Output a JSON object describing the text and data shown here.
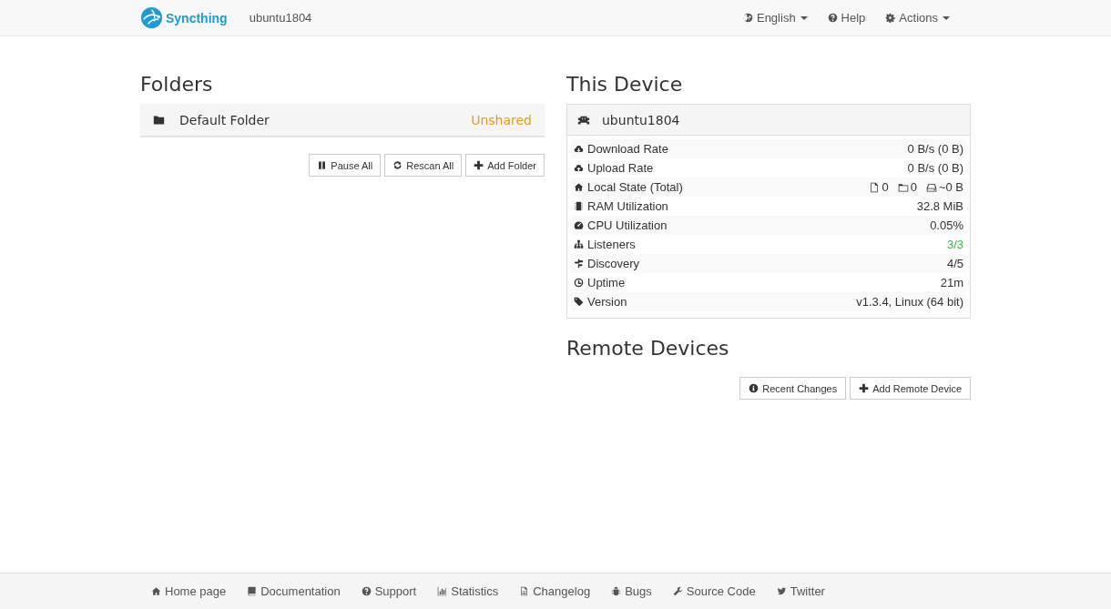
{
  "navbar": {
    "brand": "Syncthing",
    "device_name": "ubuntu1804",
    "menu": [
      {
        "label": "English",
        "dropdown": true
      },
      {
        "label": "Help",
        "dropdown": false
      },
      {
        "label": "Actions",
        "dropdown": true
      }
    ]
  },
  "folders": {
    "title": "Folders",
    "items": [
      {
        "name": "Default Folder",
        "status": "Unshared"
      }
    ],
    "buttons": [
      "Pause All",
      "Rescan All",
      "Add Folder"
    ]
  },
  "this_device": {
    "title": "This Device",
    "name": "ubuntu1804",
    "stats": [
      {
        "kind": "text",
        "label": "Download Rate",
        "value": "0 B/s (0 B)"
      },
      {
        "kind": "text",
        "label": "Upload Rate",
        "value": "0 B/s (0 B)"
      },
      {
        "kind": "counts",
        "label": "Local State (Total)",
        "files": "0",
        "folders": "0",
        "size": "~0 B"
      },
      {
        "kind": "text",
        "label": "RAM Utilization",
        "value": "32.8 MiB"
      },
      {
        "kind": "text",
        "label": "CPU Utilization",
        "value": "0.05%"
      },
      {
        "kind": "text",
        "label": "Listeners",
        "value": "3/3",
        "color": "#3cb64d"
      },
      {
        "kind": "text",
        "label": "Discovery",
        "value": "4/5"
      },
      {
        "kind": "text",
        "label": "Uptime",
        "value": "21m"
      },
      {
        "kind": "text",
        "label": "Version",
        "value": "v1.3.4, Linux (64 bit)"
      }
    ]
  },
  "remote_devices": {
    "title": "Remote Devices",
    "buttons": [
      "Recent Changes",
      "Add Remote Device"
    ]
  },
  "footer": [
    "Home page",
    "Documentation",
    "Support",
    "Statistics",
    "Changelog",
    "Bugs",
    "Source Code",
    "Twitter"
  ]
}
